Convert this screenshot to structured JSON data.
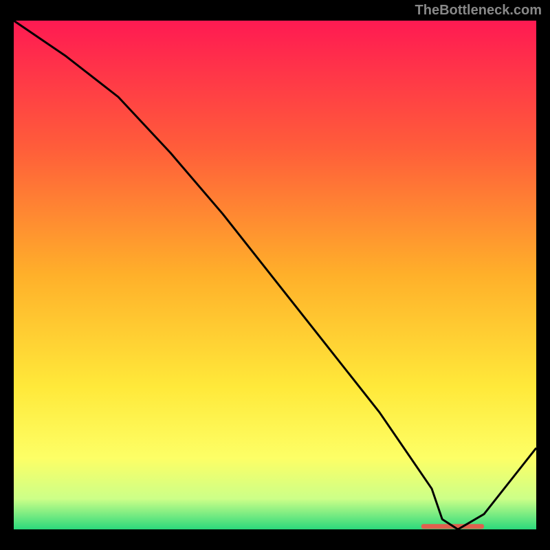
{
  "watermark": "TheBottleneck.com",
  "chart_data": {
    "type": "line",
    "title": "",
    "xlabel": "",
    "ylabel": "",
    "xlim": [
      0,
      100
    ],
    "ylim": [
      0,
      100
    ],
    "x": [
      0,
      10,
      20,
      30,
      40,
      50,
      60,
      70,
      80,
      82,
      85,
      90,
      100
    ],
    "y": [
      100,
      93,
      85,
      74,
      62,
      49,
      36,
      23,
      8,
      2,
      0,
      3,
      16
    ],
    "marker_zone": {
      "x_start": 78,
      "x_end": 90,
      "y": 0.5
    },
    "gradient_stops": [
      {
        "offset": 0,
        "color": "#ff1a52"
      },
      {
        "offset": 0.25,
        "color": "#ff5d3a"
      },
      {
        "offset": 0.5,
        "color": "#ffb02a"
      },
      {
        "offset": 0.72,
        "color": "#ffe93a"
      },
      {
        "offset": 0.86,
        "color": "#fdff66"
      },
      {
        "offset": 0.94,
        "color": "#ccff88"
      },
      {
        "offset": 1.0,
        "color": "#2bd97c"
      }
    ]
  }
}
